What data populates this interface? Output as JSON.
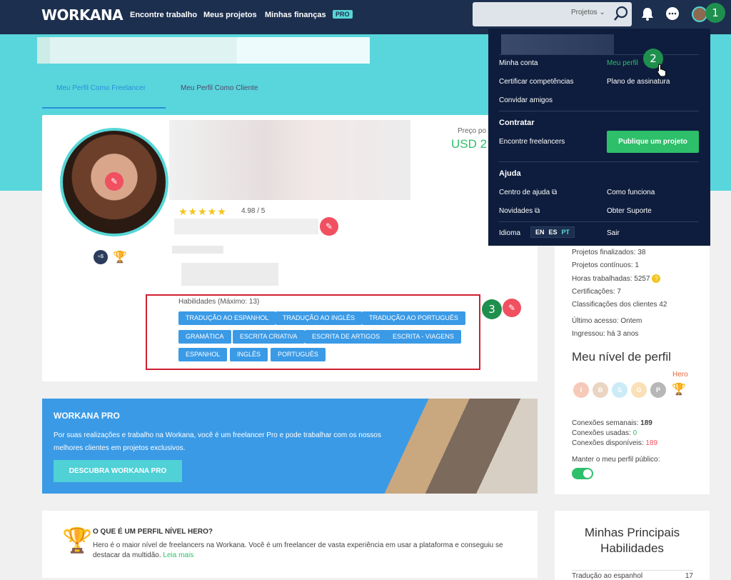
{
  "topbar": {
    "logo": "WORKANA",
    "nav": [
      "Encontre trabalho",
      "Meus projetos",
      "Minhas finanças"
    ],
    "pro_badge": "PRO",
    "search_scope": "Projetos ⌄"
  },
  "steps": [
    "1",
    "2",
    "3"
  ],
  "profile": {
    "tabs": [
      "Meu Perfil Como Freelancer",
      "Meu Perfil Como Cliente"
    ],
    "rating": "4.98 / 5",
    "stars": "★★★★★",
    "price_label": "Preço po",
    "price_value": "USD 2",
    "skills_title": "Habilidades (Máximo: 13)",
    "skills": [
      "TRADUÇÃO AO ESPANHOL",
      "TRADUÇÃO AO INGLÊS",
      "TRADUÇÃO AO PORTUGUÊS",
      "GRAMÁTICA",
      "ESCRITA CRIATIVA",
      "ESCRITA DE ARTIGOS",
      "ESCRITA - VIAGENS",
      "ESPANHOL",
      "INGLÊS",
      "PORTUGUÊS"
    ]
  },
  "pro_banner": {
    "title": "WORKANA PRO",
    "text": "Por suas realizações e trabalho na Workana, você é um freelancer Pro e pode trabalhar com os nossos melhores clientes em projetos exclusivos.",
    "button": "DESCUBRA WORKANA PRO"
  },
  "hero_info": {
    "question": "O QUE É UM PERFIL NÍVEL HERO?",
    "text": "Hero é o maior nível de freelancers na Workana. Você é um freelancer de vasta experiência em usar a plataforma e conseguiu se destacar da multidão.",
    "link": "Leia mais"
  },
  "side": {
    "stats": [
      "Projetos finalizados: 38",
      "Projetos contínuos: 1",
      "Horas trabalhadas: 5257",
      "Certificações: 7",
      "Classificações dos clientes 42",
      "Último acesso: Ontem",
      "Ingressou: há 3 anos"
    ],
    "level_title": "Meu nível de perfil",
    "level_current": "Hero",
    "levels": [
      "I",
      "B",
      "S",
      "G",
      "P",
      "H"
    ],
    "conn_weekly_label": "Conexões semanais:",
    "conn_weekly": "189",
    "conn_used_label": "Conexões usadas:",
    "conn_used": "0",
    "conn_avail_label": "Conexões disponíveis:",
    "conn_avail": "189",
    "public_label": "Manter o meu perfil público:",
    "skills_title": "Minhas Principais Habilidades",
    "top_skill": "Tradução ao espanhol",
    "top_skill_count": "17"
  },
  "dropdown": {
    "minha_conta": "Minha conta",
    "meu_perfil": "Meu perfil",
    "certificar": "Certificar competências",
    "plano": "Plano de assinatura",
    "convidar": "Convidar amigos",
    "contratar": "Contratar",
    "encontre": "Encontre freelancers",
    "publique": "Publique um projeto",
    "ajuda": "Ajuda",
    "centro": "Centro de ajuda ⧉",
    "como": "Como funciona",
    "novidades": "Novidades ⧉",
    "suporte": "Obter Suporte",
    "idioma": "Idioma",
    "langs": [
      "EN",
      "ES",
      "PT"
    ],
    "sair": "Sair"
  },
  "colors": {
    "navy": "#1d2f4e",
    "teal": "#58d6dc",
    "blue": "#3a9ae6",
    "green": "#2dbf6a",
    "red": "#f05060"
  }
}
